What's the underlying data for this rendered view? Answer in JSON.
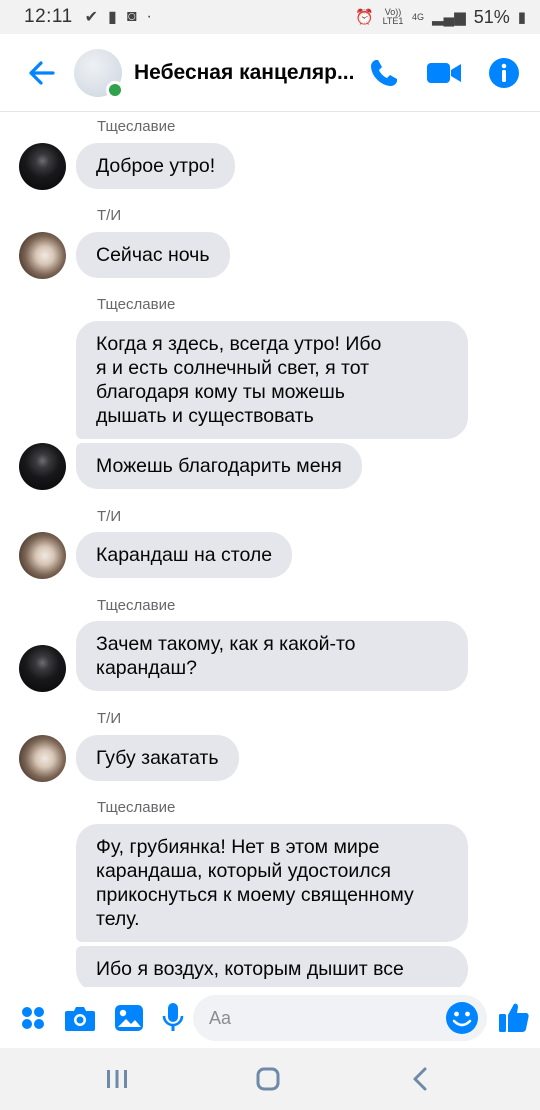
{
  "status_bar": {
    "time": "12:11",
    "battery": "51%",
    "network_top": "Vo)) LTE1",
    "network_type": "4G"
  },
  "header": {
    "title": "Небесная канцеляр...",
    "back_icon": "arrow-left-icon",
    "call_icon": "phone-icon",
    "video_icon": "video-camera-icon",
    "info_icon": "info-icon",
    "accent_color": "#0084ff",
    "online_color": "#31a24c"
  },
  "messages": [
    {
      "sender": "Тщеславие",
      "bubbles": [
        "Доброе утро!"
      ]
    },
    {
      "sender": "Т/И",
      "bubbles": [
        "Сейчас ночь"
      ]
    },
    {
      "sender": "Тщеславие",
      "bubbles": [
        "Когда я здесь, всегда утро! Ибо\nя и есть солнечный свет, я тот\nблагодаря кому ты можешь\nдышать и существовать",
        "Можешь благодарить меня"
      ]
    },
    {
      "sender": "Т/И",
      "bubbles": [
        "Карандаш  на столе"
      ]
    },
    {
      "sender": "Тщеславие",
      "bubbles": [
        "Зачем такому, как я какой-то\nкарандаш?"
      ]
    },
    {
      "sender": "Т/И",
      "bubbles": [
        "Губу закатать"
      ]
    },
    {
      "sender": "Тщеславие",
      "bubbles": [
        "Фу, грубиянка! Нет в этом мире\nкарандаша, который удостоился\nприкоснуться к моему священному\nтелу.",
        "Ибо я воздух, которым дышит все"
      ]
    }
  ],
  "composer": {
    "placeholder": "Aa",
    "icons": [
      "menu-dots-icon",
      "camera-icon",
      "gallery-icon",
      "microphone-icon",
      "emoji-icon",
      "thumbs-up-icon"
    ]
  },
  "nav_bar": {
    "icons": [
      "recent-apps-icon",
      "home-icon",
      "back-icon"
    ]
  }
}
